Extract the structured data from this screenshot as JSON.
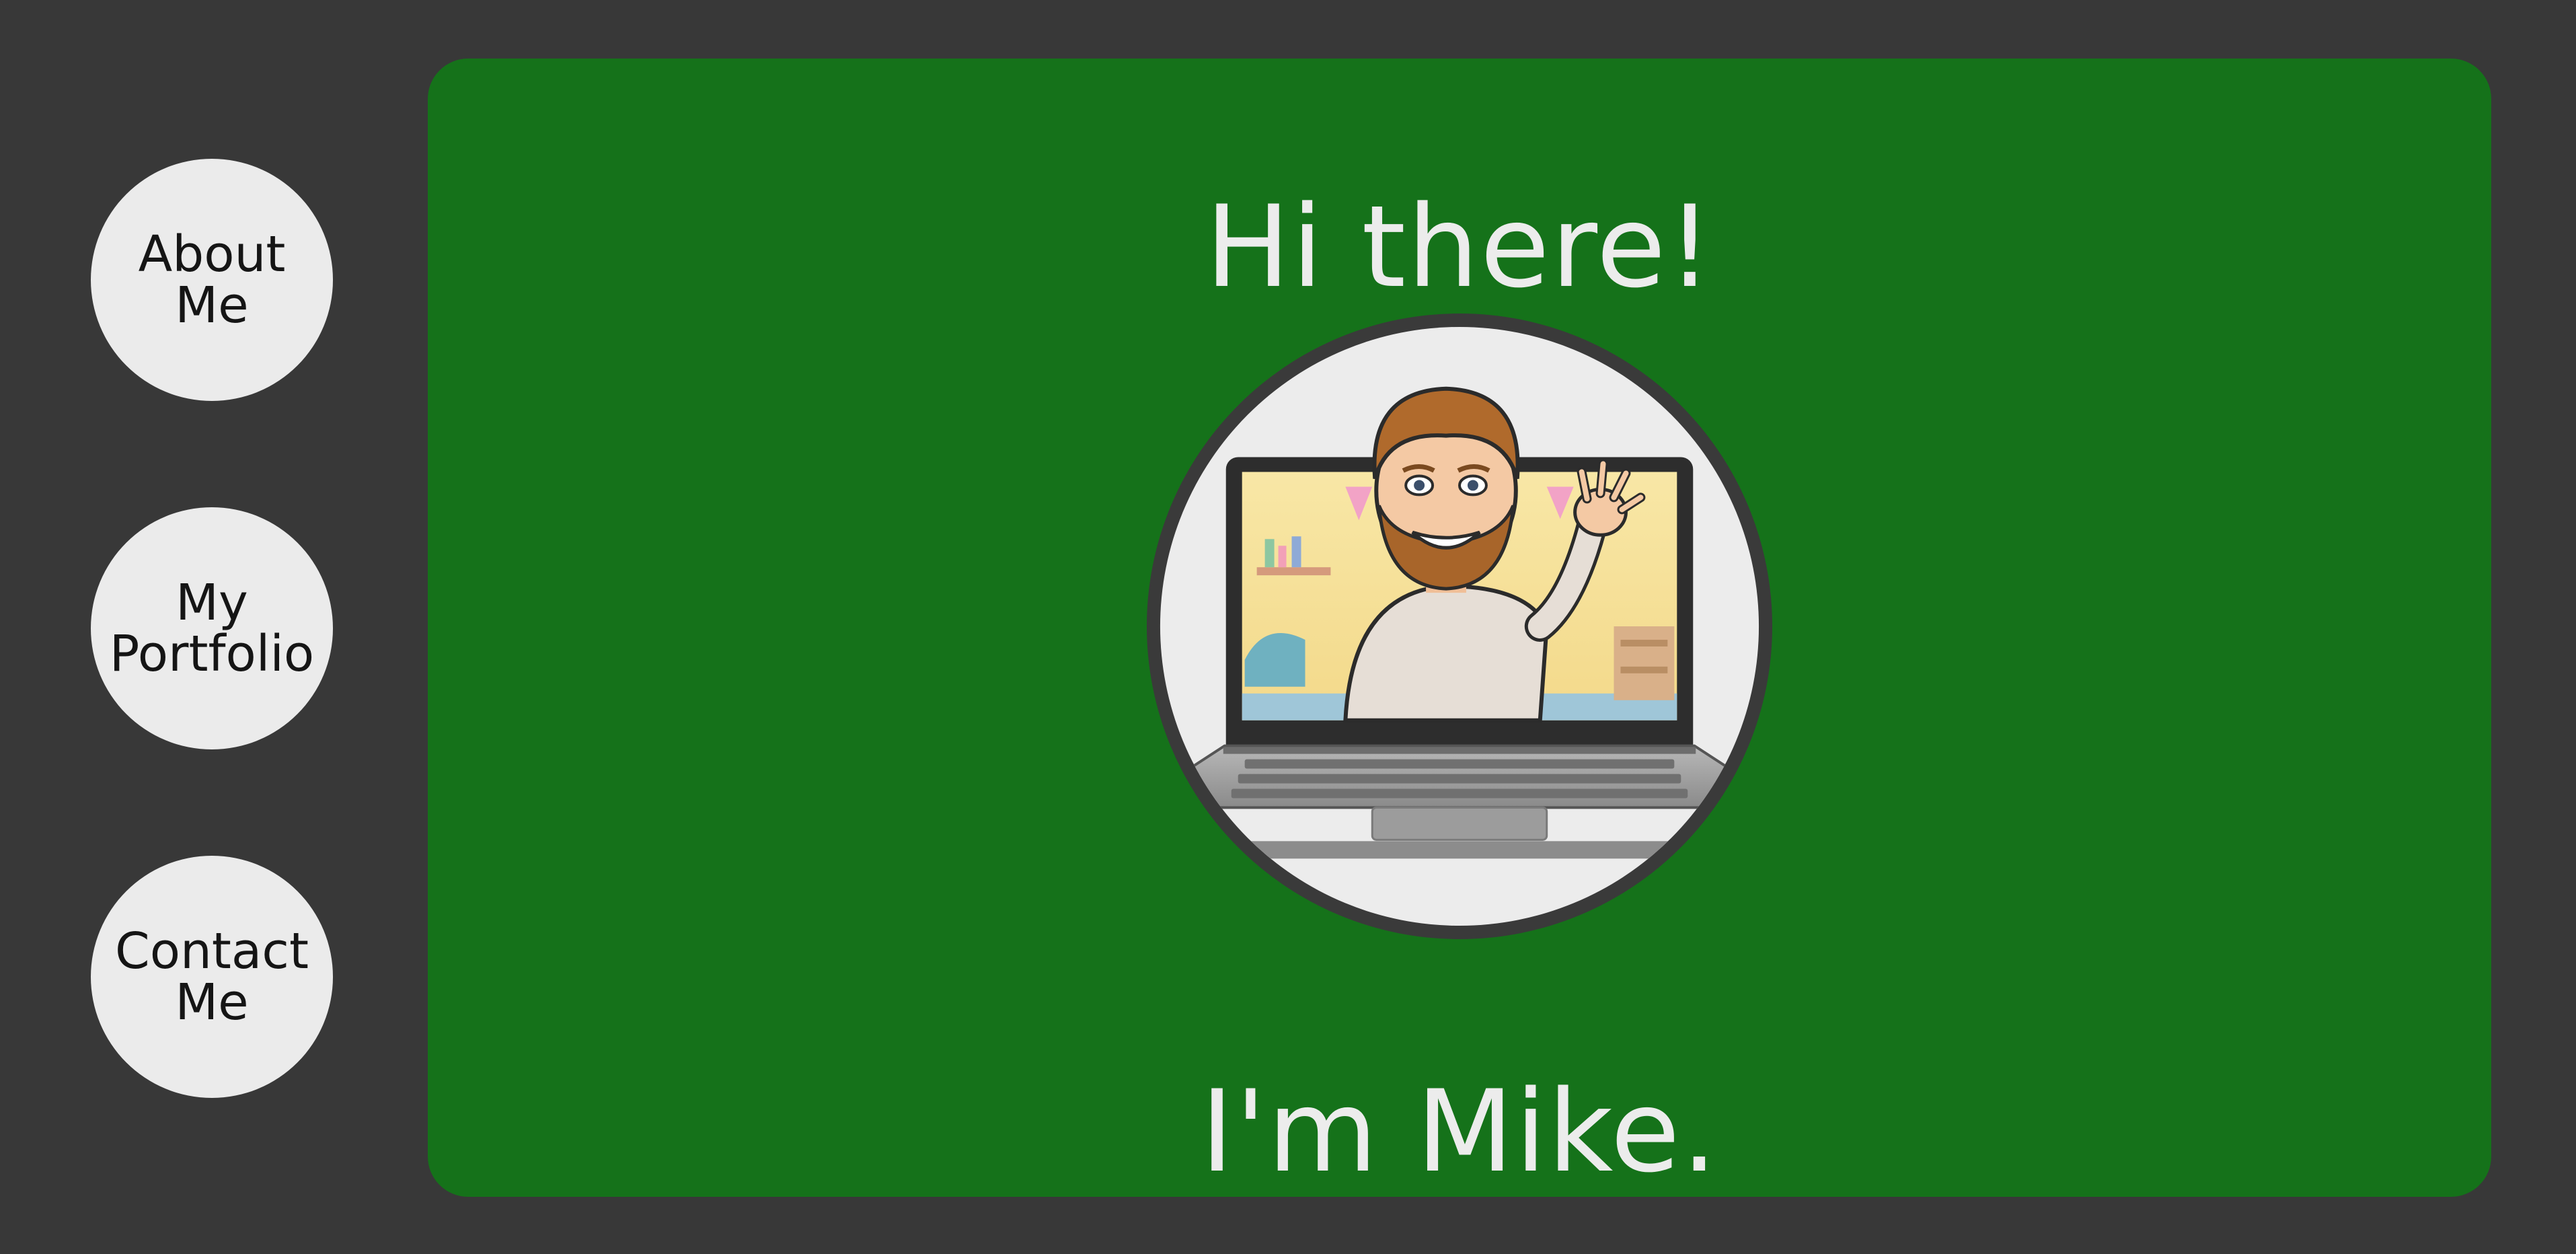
{
  "nav": {
    "items": [
      {
        "label": "About\nMe"
      },
      {
        "label": "My\nPortfolio"
      },
      {
        "label": "Contact\nMe"
      }
    ]
  },
  "main": {
    "greeting": "Hi there!",
    "intro": "I'm Mike."
  },
  "colors": {
    "page_bg": "#383838",
    "panel_bg": "#15721a",
    "text_light": "#ececec",
    "nav_button_bg": "#ebebeb"
  },
  "avatar": {
    "icon": "bitmoji-avatar-on-laptop"
  }
}
